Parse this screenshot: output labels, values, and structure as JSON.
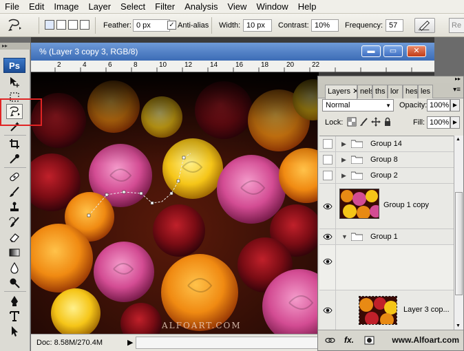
{
  "menu": [
    "File",
    "Edit",
    "Image",
    "Layer",
    "Select",
    "Filter",
    "Analysis",
    "View",
    "Window",
    "Help"
  ],
  "options": {
    "feather_label": "Feather:",
    "feather_value": "0 px",
    "antialias_label": "Anti-alias",
    "antialias_checked": "✓",
    "width_label": "Width:",
    "width_value": "10 px",
    "contrast_label": "Contrast:",
    "contrast_value": "10%",
    "frequency_label": "Frequency:",
    "frequency_value": "57",
    "refine_label": "Re"
  },
  "toolbar": {
    "app_logo": "Ps",
    "tools": [
      "move-icon",
      "marquee-icon",
      "magnetic-lasso-icon",
      "magic-wand-icon",
      "crop-icon",
      "eyedropper-icon",
      "healing-brush-icon",
      "brush-icon",
      "clone-stamp-icon",
      "history-brush-icon",
      "eraser-icon",
      "gradient-icon",
      "blur-icon",
      "dodge-icon",
      "pen-icon",
      "type-icon",
      "path-selection-icon"
    ]
  },
  "document": {
    "title": "% (Layer 3 copy 3, RGB/8)",
    "ruler_ticks": [
      "2",
      "4",
      "6",
      "8",
      "10",
      "12",
      "14",
      "16",
      "18",
      "20",
      "22"
    ],
    "watermark": "ALFOART.COM",
    "status": "Doc: 8.58M/270.4M"
  },
  "layers_panel": {
    "tabs": [
      "Layers",
      "nels",
      "ths",
      "lor",
      "hes",
      "les"
    ],
    "blend_mode": "Normal",
    "opacity_label": "Opacity:",
    "opacity_value": "100%",
    "lock_label": "Lock:",
    "fill_label": "Fill:",
    "fill_value": "100%",
    "layers": [
      {
        "name": "Group 14",
        "type": "group",
        "visible": false
      },
      {
        "name": "Group 8",
        "type": "group",
        "visible": false
      },
      {
        "name": "Group 2",
        "type": "group",
        "visible": false
      },
      {
        "name": "Group 1 copy",
        "type": "layer",
        "visible": true
      },
      {
        "name": "Group 1",
        "type": "group-open",
        "visible": true
      },
      {
        "name": "",
        "type": "empty",
        "visible": true
      },
      {
        "name": "Layer 3 cop...",
        "type": "layer",
        "visible": true
      }
    ],
    "footer_site": "www.Alfoart.com"
  },
  "colors": {
    "accent_highlight": "#e02424",
    "title_blue": "#3c6cb6"
  }
}
